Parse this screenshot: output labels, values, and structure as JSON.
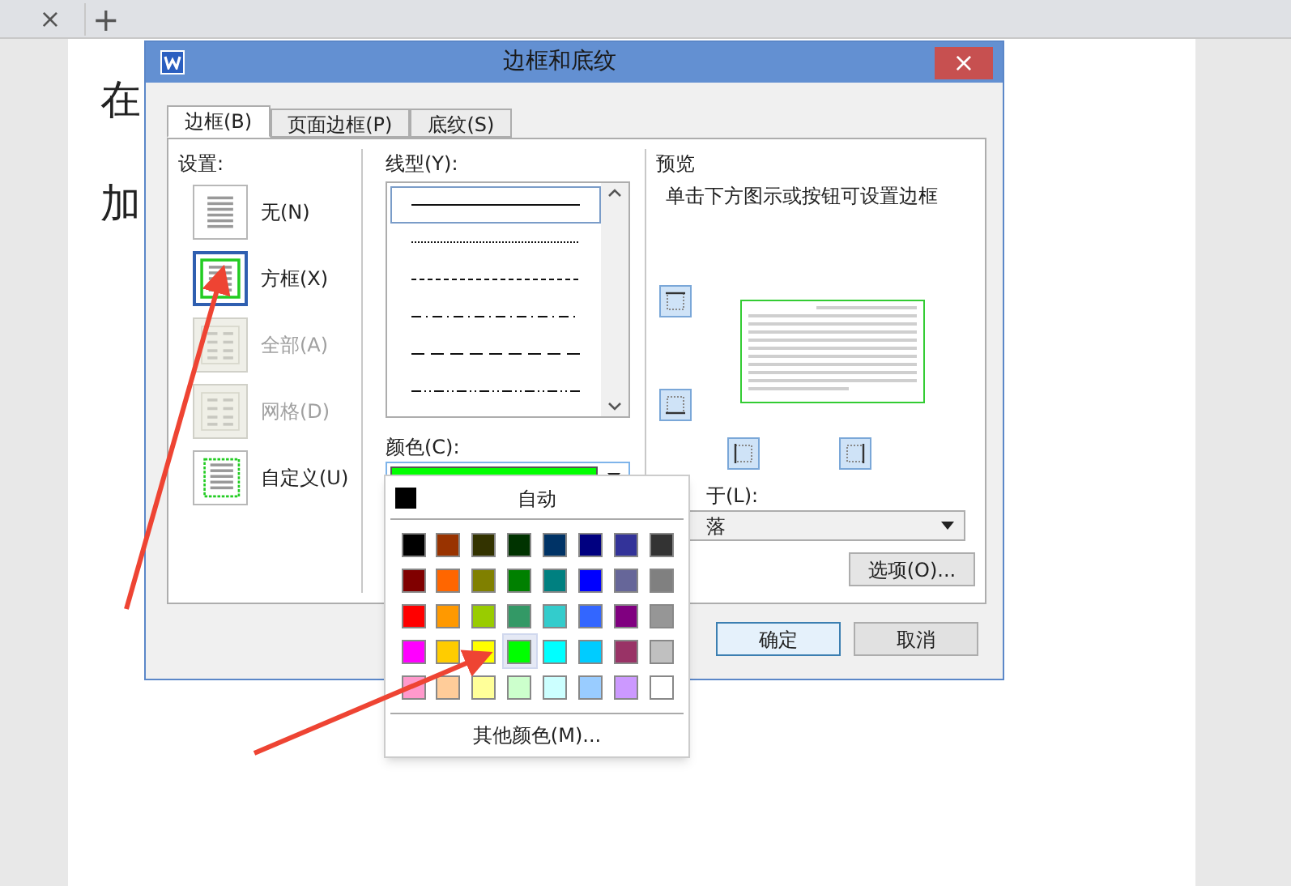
{
  "browser_tabs": {
    "close": "×",
    "new": "+"
  },
  "document": {
    "lines": [
      "在",
      "加"
    ]
  },
  "dialog": {
    "title": "边框和底纹",
    "close": "×",
    "tabs": [
      {
        "label": "边框(B)",
        "selected": true
      },
      {
        "label": "页面边框(P)",
        "selected": false
      },
      {
        "label": "底纹(S)",
        "selected": false
      }
    ],
    "settings": {
      "label": "设置:",
      "items": [
        {
          "label": "无(N)",
          "kind": "none",
          "selected": false,
          "disabled": false
        },
        {
          "label": "方框(X)",
          "kind": "box",
          "selected": true,
          "disabled": false
        },
        {
          "label": "全部(A)",
          "kind": "all",
          "selected": false,
          "disabled": true
        },
        {
          "label": "网格(D)",
          "kind": "grid",
          "selected": false,
          "disabled": true
        },
        {
          "label": "自定义(U)",
          "kind": "custom",
          "selected": false,
          "disabled": false
        }
      ]
    },
    "line_style": {
      "label": "线型(Y):",
      "styles": [
        {
          "kind": "solid",
          "selected": true
        },
        {
          "kind": "dotted",
          "selected": false
        },
        {
          "kind": "dashed",
          "selected": false
        },
        {
          "kind": "dash-dot",
          "selected": false
        },
        {
          "kind": "long-dash",
          "selected": false
        },
        {
          "kind": "dash-dot-dot",
          "selected": false
        }
      ]
    },
    "color": {
      "label": "颜色(C):"
    },
    "preview": {
      "label": "预览",
      "hint": "单击下方图示或按钮可设置边框"
    },
    "apply_to": {
      "label": "于(L):",
      "value": "落"
    },
    "options_button": "选项(O)...",
    "buttons": [
      {
        "label": "确定",
        "selected": true
      },
      {
        "label": "取消",
        "selected": false
      }
    ]
  },
  "color_popup": {
    "auto": "自动",
    "more": "其他颜色(M)...",
    "swatches": [
      {
        "color": "#000000",
        "selected": false
      },
      {
        "color": "#993300",
        "selected": false
      },
      {
        "color": "#333300",
        "selected": false
      },
      {
        "color": "#003300",
        "selected": false
      },
      {
        "color": "#003366",
        "selected": false
      },
      {
        "color": "#000080",
        "selected": false
      },
      {
        "color": "#333399",
        "selected": false
      },
      {
        "color": "#333333",
        "selected": false
      },
      {
        "color": "#800000",
        "selected": false
      },
      {
        "color": "#ff6600",
        "selected": false
      },
      {
        "color": "#808000",
        "selected": false
      },
      {
        "color": "#008000",
        "selected": false
      },
      {
        "color": "#008080",
        "selected": false
      },
      {
        "color": "#0000ff",
        "selected": false
      },
      {
        "color": "#666699",
        "selected": false
      },
      {
        "color": "#808080",
        "selected": false
      },
      {
        "color": "#ff0000",
        "selected": false
      },
      {
        "color": "#ff9900",
        "selected": false
      },
      {
        "color": "#99cc00",
        "selected": false
      },
      {
        "color": "#339966",
        "selected": false
      },
      {
        "color": "#33cccc",
        "selected": false
      },
      {
        "color": "#3366ff",
        "selected": false
      },
      {
        "color": "#800080",
        "selected": false
      },
      {
        "color": "#969696",
        "selected": false
      },
      {
        "color": "#ff00ff",
        "selected": false
      },
      {
        "color": "#ffcc00",
        "selected": false
      },
      {
        "color": "#ffff00",
        "selected": false
      },
      {
        "color": "#00ff00",
        "selected": true
      },
      {
        "color": "#00ffff",
        "selected": false
      },
      {
        "color": "#00ccff",
        "selected": false
      },
      {
        "color": "#993366",
        "selected": false
      },
      {
        "color": "#c0c0c0",
        "selected": false
      },
      {
        "color": "#ff99cc",
        "selected": false
      },
      {
        "color": "#ffcc99",
        "selected": false
      },
      {
        "color": "#ffff99",
        "selected": false
      },
      {
        "color": "#ccffcc",
        "selected": false
      },
      {
        "color": "#ccffff",
        "selected": false
      },
      {
        "color": "#99ccff",
        "selected": false
      },
      {
        "color": "#cc99ff",
        "selected": false
      },
      {
        "color": "#ffffff",
        "selected": false
      }
    ]
  }
}
